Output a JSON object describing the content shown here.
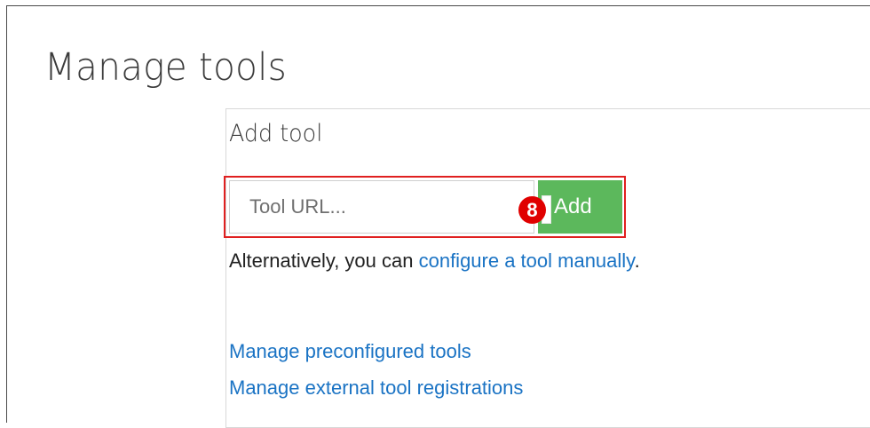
{
  "page": {
    "title": "Manage tools"
  },
  "add_tool": {
    "heading": "Add tool",
    "url_input": {
      "placeholder": "Tool URL...",
      "value": ""
    },
    "add_button_label": "Add",
    "step_badge": "8",
    "alternative": {
      "prefix": "Alternatively, you can ",
      "link_text": "configure a tool manually",
      "suffix": "."
    }
  },
  "links": {
    "preconfigured": "Manage preconfigured tools",
    "external_registrations": "Manage external tool registrations"
  },
  "colors": {
    "link": "#1a73c4",
    "add_button": "#5cb85c",
    "highlight": "#e02020",
    "badge": "#e00000"
  }
}
